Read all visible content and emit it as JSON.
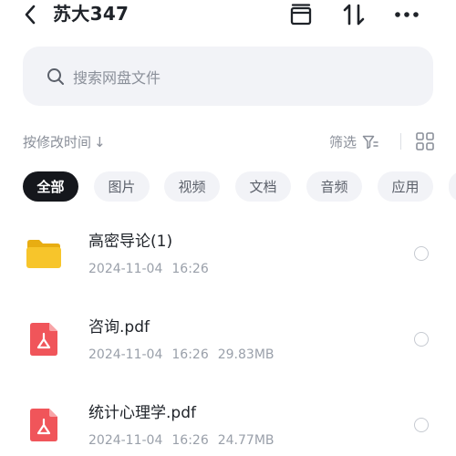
{
  "header": {
    "title": "苏大347",
    "back_icon": "chevron-left-icon",
    "archive_icon": "archive-box-icon",
    "sort_icon": "sort-arrows-icon",
    "more_icon": "more-dots-icon"
  },
  "search": {
    "placeholder": "搜索网盘文件"
  },
  "sort": {
    "label": "按修改时间",
    "arrow": "↓",
    "filter_label": "筛选"
  },
  "chips": [
    {
      "label": "全部",
      "active": true
    },
    {
      "label": "图片",
      "active": false
    },
    {
      "label": "视频",
      "active": false
    },
    {
      "label": "文档",
      "active": false
    },
    {
      "label": "音频",
      "active": false
    },
    {
      "label": "应用",
      "active": false
    }
  ],
  "files": [
    {
      "name": "高密导论(1)",
      "date": "2024-11-04",
      "time": "16:26",
      "size": "",
      "type": "folder"
    },
    {
      "name": "咨询.pdf",
      "date": "2024-11-04",
      "time": "16:26",
      "size": "29.83MB",
      "type": "pdf"
    },
    {
      "name": "统计心理学.pdf",
      "date": "2024-11-04",
      "time": "16:26",
      "size": "24.77MB",
      "type": "pdf"
    }
  ],
  "colors": {
    "folder": "#f7c52b",
    "pdf": "#f0555a",
    "active_chip": "#15171c",
    "chip_bg": "#f2f3f7"
  }
}
